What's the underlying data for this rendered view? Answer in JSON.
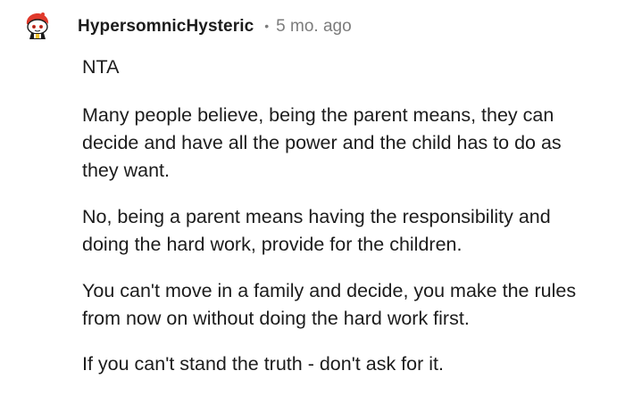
{
  "comment": {
    "author": "HypersomnicHysteric",
    "separator": "•",
    "age": "5 mo. ago",
    "avatar_icon": "reddit-snoo-avatar-icon",
    "paragraphs": [
      "NTA",
      "Many people believe, being the parent means, they can decide and have all the power and the child has to do as they want.",
      "No, being a parent means having the responsibility and doing the hard work, provide for the children.",
      "You can't move in a family and decide, you make the rules from now on without doing the hard work first.",
      "If you can't stand the truth - don't ask for it."
    ]
  },
  "colors": {
    "text": "#1c1c1c",
    "meta": "#7c7c7c",
    "avatar_red": "#e0392b",
    "background": "#ffffff"
  }
}
